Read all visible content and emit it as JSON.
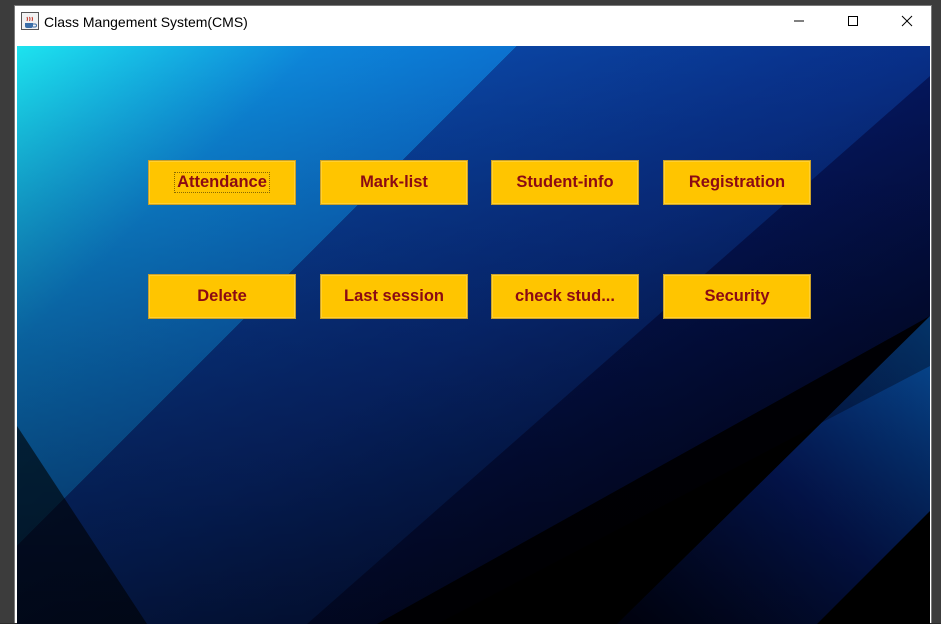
{
  "window": {
    "title": "Class Mangement System(CMS)",
    "app_icon": "java-coffee-cup-icon",
    "controls": {
      "minimize_icon": "minimize-icon",
      "maximize_icon": "maximize-icon",
      "close_icon": "close-icon"
    }
  },
  "main": {
    "buttons_row1": [
      {
        "label": "Attendance"
      },
      {
        "label": "Mark-list"
      },
      {
        "label": "Student-info"
      },
      {
        "label": "Registration"
      }
    ],
    "buttons_row2": [
      {
        "label": "Delete"
      },
      {
        "label": "Last session"
      },
      {
        "label": "check stud..."
      },
      {
        "label": "Security"
      }
    ]
  },
  "colors": {
    "button_bg": "#ffc500",
    "button_text": "#8b0a14",
    "background_accent": "#0a63c8"
  }
}
